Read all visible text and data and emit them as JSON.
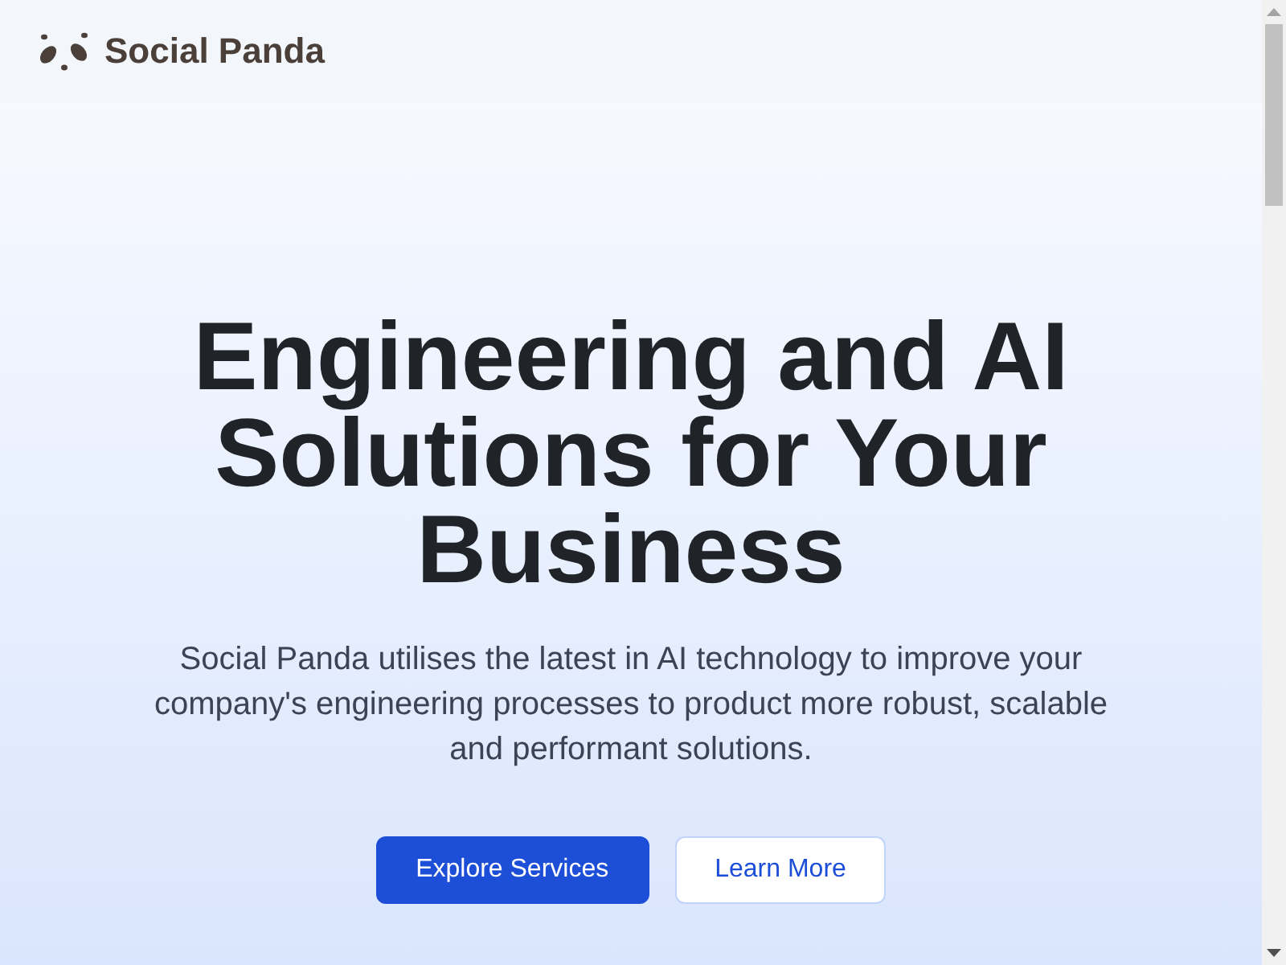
{
  "header": {
    "brand": "Social Panda"
  },
  "hero": {
    "title": "Engineering and AI Solutions for Your Business",
    "description": "Social Panda utilises the latest in AI technology to improve your company's engineering processes to product more robust, scalable and performant solutions.",
    "buttons": [
      {
        "label": "Explore Services",
        "kind": "primary"
      },
      {
        "label": "Learn More",
        "kind": "secondary"
      }
    ]
  }
}
